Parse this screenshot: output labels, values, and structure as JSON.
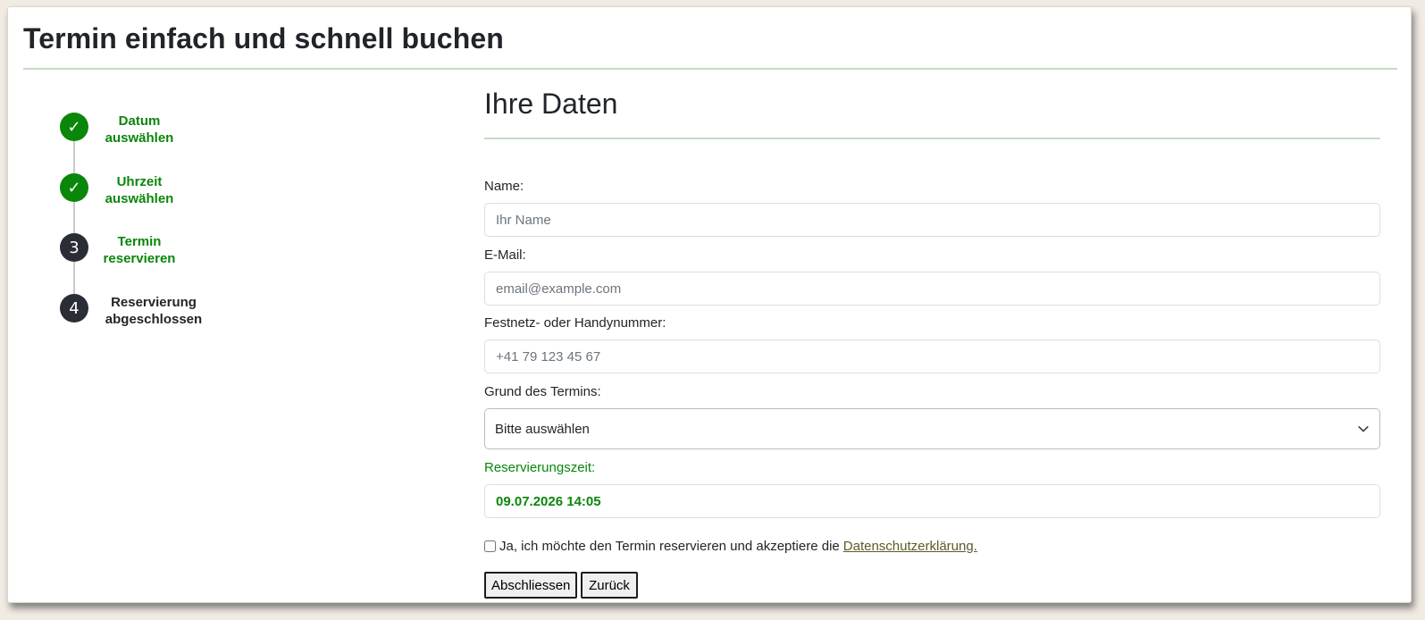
{
  "page_title": "Termin einfach und schnell buchen",
  "colors": {
    "accent_green": "#0a860a",
    "pending_dark": "#2b2d36",
    "rule_green": "#c5dcc3"
  },
  "stepper": {
    "steps": [
      {
        "marker": "✓",
        "line1": "Datum",
        "line2": "auswählen",
        "state": "done"
      },
      {
        "marker": "✓",
        "line1": "Uhrzeit",
        "line2": "auswählen",
        "state": "done"
      },
      {
        "marker": "3",
        "line1": "Termin",
        "line2": "reservieren",
        "state": "current"
      },
      {
        "marker": "4",
        "line1": "Reservierung",
        "line2": "abgeschlossen",
        "state": "pending"
      }
    ]
  },
  "form": {
    "section_title": "Ihre Daten",
    "name": {
      "label": "Name:",
      "placeholder": "Ihr Name",
      "value": ""
    },
    "email": {
      "label": "E-Mail:",
      "placeholder": "email@example.com",
      "value": ""
    },
    "phone": {
      "label": "Festnetz- oder Handynummer:",
      "placeholder": "+41 79 123 45 67",
      "value": ""
    },
    "reason": {
      "label": "Grund des Termins:",
      "selected": "Bitte auswählen",
      "icon": "chevron-down-icon"
    },
    "reservation": {
      "label": "Reservierungszeit:",
      "value": "09.07.2026 14:05"
    },
    "consent": {
      "checked": false,
      "text": "Ja, ich möchte den Termin reservieren und akzeptiere die",
      "link_text": "Datenschutzerklärung."
    },
    "buttons": {
      "submit": "Abschliessen",
      "back": "Zurück"
    }
  }
}
